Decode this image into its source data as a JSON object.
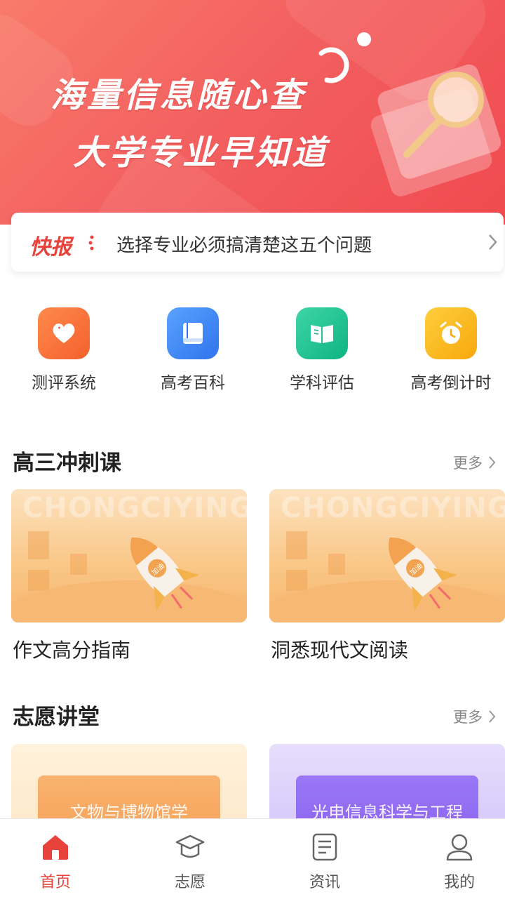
{
  "banner": {
    "line1": "海量信息随心查",
    "line2": "大学专业早知道"
  },
  "ticker": {
    "tag": "快报",
    "text": "选择专业必须搞清楚这五个问题"
  },
  "quick_menu": [
    {
      "label": "测评系统",
      "icon": "heart-icon",
      "color": "#f7663a"
    },
    {
      "label": "高考百科",
      "icon": "book-icon",
      "color": "#3c86f5"
    },
    {
      "label": "学科评估",
      "icon": "open-book-icon",
      "color": "#16c090"
    },
    {
      "label": "高考倒计时",
      "icon": "alarm-clock-icon",
      "color": "#f9b516"
    }
  ],
  "sprint": {
    "title": "高三冲刺课",
    "more": "更多",
    "cards": [
      {
        "watermark": "CHONGCIYING",
        "badge": "加油",
        "label": "作文高分指南"
      },
      {
        "watermark": "CHONGCIYING",
        "badge": "加油",
        "label": "洞悉现代文阅读"
      }
    ]
  },
  "lecture": {
    "title": "志愿讲堂",
    "more": "更多",
    "cards": [
      {
        "text": "文物与博物馆学"
      },
      {
        "text": "光电信息科学与工程"
      }
    ]
  },
  "tabbar": [
    {
      "label": "首页",
      "icon": "home-icon",
      "active": true
    },
    {
      "label": "志愿",
      "icon": "graduation-cap-icon",
      "active": false
    },
    {
      "label": "资讯",
      "icon": "news-icon",
      "active": false
    },
    {
      "label": "我的",
      "icon": "user-icon",
      "active": false
    }
  ],
  "colors": {
    "accent": "#e8433a",
    "banner": "#f36060",
    "card": "#f9c889"
  }
}
